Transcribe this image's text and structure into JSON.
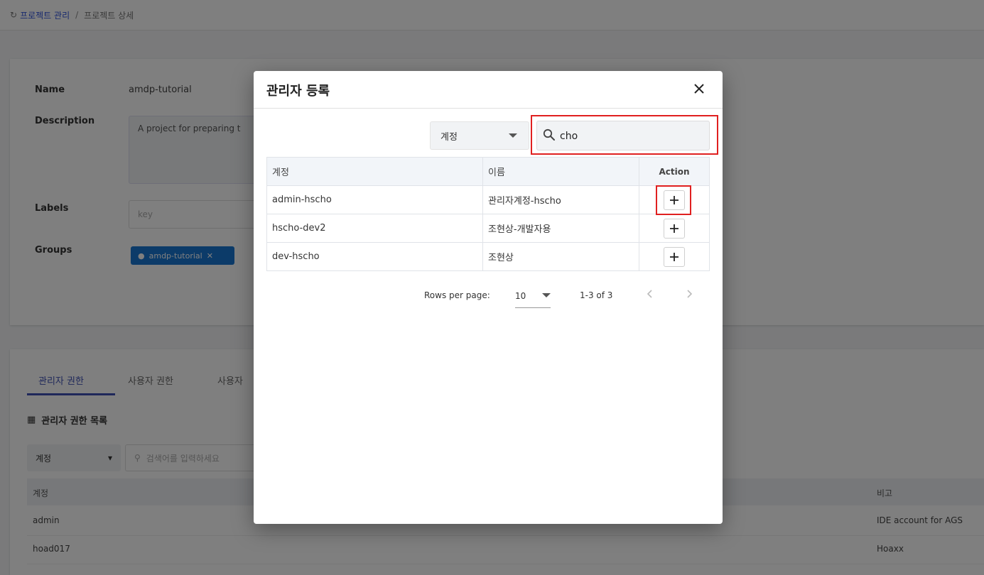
{
  "background": {
    "breadcrumb": {
      "link": "프로젝트 관리",
      "current": "프로젝트 상세"
    },
    "fields": {
      "name_label": "Name",
      "name_value": "amdp-tutorial",
      "description_label": "Description",
      "description_value": "A project for preparing t",
      "labels_label": "Labels",
      "labels_placeholder": "key",
      "groups_label": "Groups",
      "group_chip": "amdp-tutorial"
    },
    "tabs": [
      "관리자 권한",
      "사용자 권한",
      "사용자"
    ],
    "list_title": "관리자 권한 목록",
    "filter_select": "계정",
    "search_placeholder": "검색어를 입력하세요",
    "table_headers": {
      "account": "계정",
      "note": "비고"
    },
    "rows": [
      {
        "account": "admin",
        "note": "IDE account for AGS"
      },
      {
        "account": "hoad017",
        "note": "Hoaxx"
      }
    ]
  },
  "modal": {
    "title": "관리자 등록",
    "filter_select": "계정",
    "search_value": "cho",
    "columns": {
      "account": "계정",
      "name": "이름",
      "action": "Action"
    },
    "rows": [
      {
        "account": "admin-hscho",
        "name": "관리자계정-hscho"
      },
      {
        "account": "hscho-dev2",
        "name": "조현상-개발자용"
      },
      {
        "account": "dev-hscho",
        "name": "조현상"
      }
    ],
    "pagination": {
      "rows_per_page_label": "Rows per page:",
      "rows_per_page": "10",
      "range": "1-3 of 3"
    }
  }
}
